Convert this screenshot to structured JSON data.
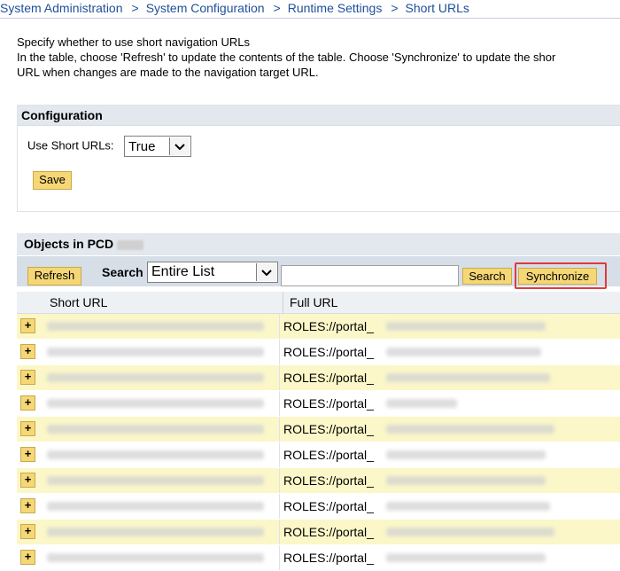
{
  "breadcrumb": [
    "System Administration",
    "System Configuration",
    "Runtime Settings",
    "Short URLs"
  ],
  "breadcrumb_sep": ">",
  "description": {
    "line1": "Specify whether to use short navigation URLs",
    "line2": "In the table, choose 'Refresh' to update the contents of the table. Choose 'Synchronize' to update the shor",
    "line3": "URL when changes are made to the navigation target URL."
  },
  "configuration": {
    "title": "Configuration",
    "use_short_urls_label": "Use Short URLs:",
    "use_short_urls_value": "True",
    "save_label": "Save"
  },
  "objects": {
    "title": "Objects in PCD",
    "refresh_label": "Refresh",
    "search_label": "Search",
    "search_scope": "Entire List",
    "search_input_value": "",
    "search_button_label": "Search",
    "synchronize_label": "Synchronize",
    "columns": [
      "Short URL",
      "Full URL"
    ],
    "expand_symbol": "+",
    "rows": [
      {
        "full_url": "ROLES://portal_"
      },
      {
        "full_url": "ROLES://portal_"
      },
      {
        "full_url": "ROLES://portal_"
      },
      {
        "full_url": "ROLES://portal_"
      },
      {
        "full_url": "ROLES://portal_"
      },
      {
        "full_url": "ROLES://portal_"
      },
      {
        "full_url": "ROLES://portal_"
      },
      {
        "full_url": "ROLES://portal_"
      },
      {
        "full_url": "ROLES://portal_"
      },
      {
        "full_url": "ROLES://portal_"
      }
    ]
  },
  "colors": {
    "link": "#1f4f9b",
    "button_fill": "#f6d776",
    "highlight_outline": "#e0393e",
    "group_header": "#e3e8ee",
    "row_highlight": "#fbf7c8"
  }
}
